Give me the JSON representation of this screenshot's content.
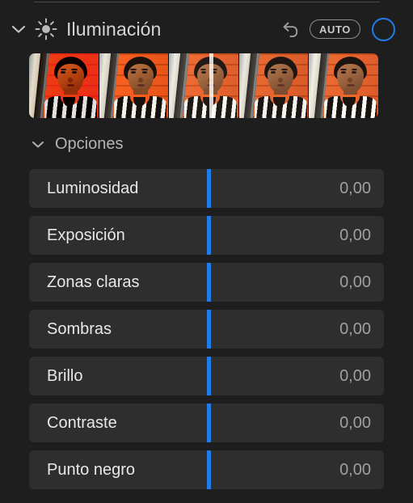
{
  "panel": {
    "title": "Iluminación",
    "icon": "sun-icon",
    "disclosure_icon": "chevron-down-icon",
    "reset_icon": "undo-arrow-icon",
    "auto_label": "AUTO",
    "toggle_icon": "circle-outline-toggle",
    "accent_color": "#1f7ce8",
    "panel_bg": "#1e1e1e",
    "row_bg": "#2e2e2e"
  },
  "filmstrip": {
    "name": "illumination-variations-filmstrip",
    "thumbnail_count": 5,
    "selected_index": 2,
    "thumbnails": [
      {
        "alt": "portrait variation 1"
      },
      {
        "alt": "portrait variation 2"
      },
      {
        "alt": "portrait variation 3"
      },
      {
        "alt": "portrait variation 4"
      },
      {
        "alt": "portrait variation 5"
      }
    ]
  },
  "options": {
    "label": "Opciones",
    "disclosure_icon": "chevron-down-icon",
    "sliders": [
      {
        "label": "Luminosidad",
        "value": "0,00"
      },
      {
        "label": "Exposición",
        "value": "0,00"
      },
      {
        "label": "Zonas claras",
        "value": "0,00"
      },
      {
        "label": "Sombras",
        "value": "0,00"
      },
      {
        "label": "Brillo",
        "value": "0,00"
      },
      {
        "label": "Contraste",
        "value": "0,00"
      },
      {
        "label": "Punto negro",
        "value": "0,00"
      }
    ]
  }
}
